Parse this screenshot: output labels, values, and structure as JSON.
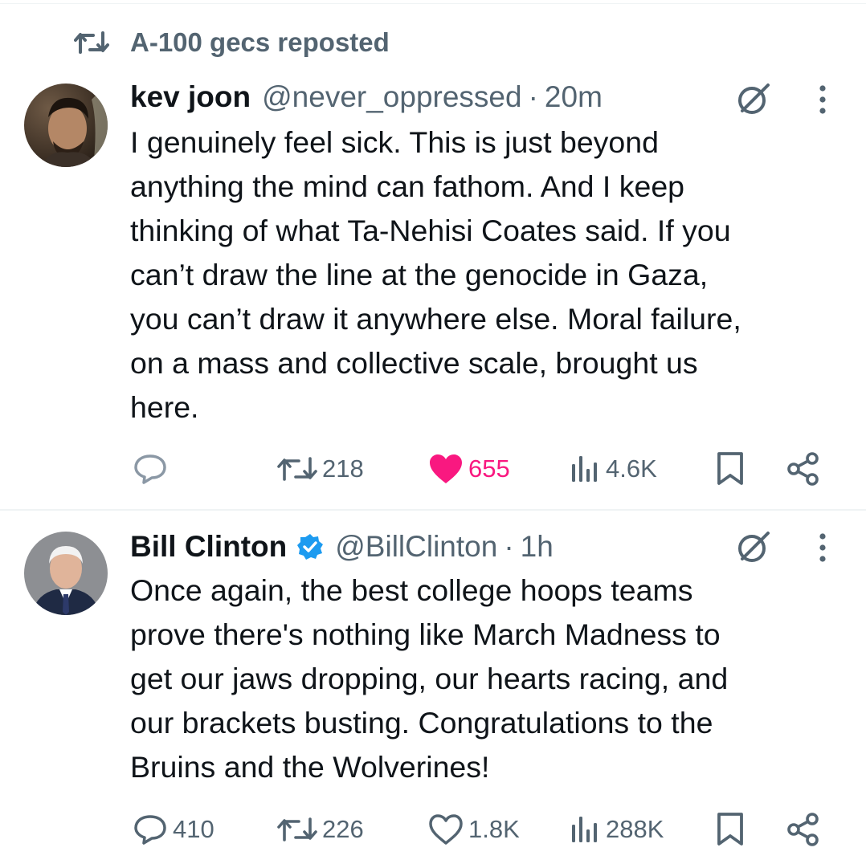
{
  "repost": {
    "icon": "repost-icon",
    "text": "A-100 gecs reposted"
  },
  "tweets": [
    {
      "name": "kev joon",
      "handle": "@never_oppressed",
      "separator": "·",
      "time": "20m",
      "text": "I genuinely feel sick. This is just beyond\nanything the mind can fathom. And I keep\nthinking of what Ta-Nehisi Coates said. If you\ncan’t draw the line at the genocide in Gaza,\nyou can’t draw it anywhere else. Moral failure,\non a mass and collective scale, brought us\nhere.",
      "replies": "",
      "reposts": "218",
      "likes": "655",
      "liked": true,
      "views": "4.6K"
    },
    {
      "name": "Bill Clinton",
      "verified": true,
      "handle": "@BillClinton",
      "separator": "·",
      "time": "1h",
      "text": "Once again, the best college hoops teams\nprove there's nothing like March Madness to\nget our jaws dropping, our hearts racing, and\nour brackets busting. Congratulations to the\nBruins and the Wolverines!",
      "replies": "410",
      "reposts": "226",
      "likes": "1.8K",
      "liked": false,
      "views": "288K"
    }
  ],
  "colors": {
    "text": "#0f1419",
    "secondary": "#536471",
    "like": "#f91880",
    "verified": "#1d9bf0",
    "divider": "#eff3f4"
  },
  "icons": {
    "reply": "reply-icon",
    "repost": "repost-icon",
    "like": "heart-icon",
    "views": "views-icon",
    "bookmark": "bookmark-icon",
    "share": "share-icon",
    "grok": "grok-icon",
    "more": "more-icon",
    "verified": "verified-badge-icon"
  }
}
